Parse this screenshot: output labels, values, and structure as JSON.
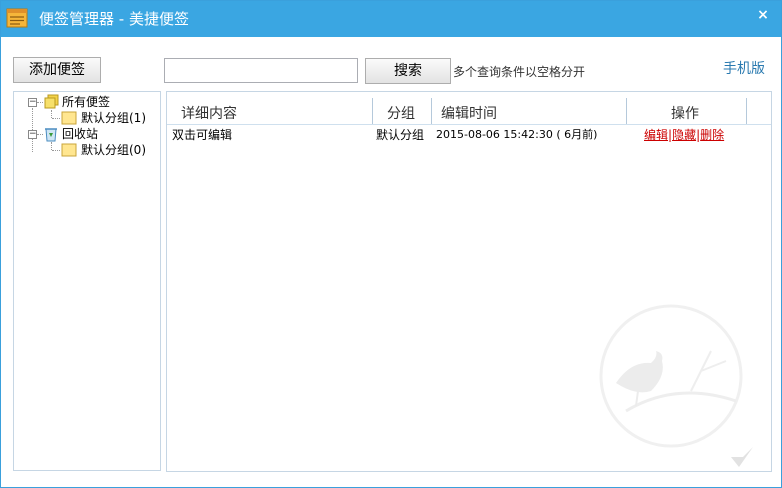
{
  "window": {
    "title": "便签管理器 - 美捷便签",
    "close_label": "×"
  },
  "toolbar": {
    "add_label": "添加便签",
    "search_value": "",
    "search_placeholder": "",
    "search_label": "搜索",
    "search_hint": "多个查询条件以空格分开",
    "mobile_label": "手机版"
  },
  "tree": {
    "all_notes": "所有便签",
    "all_default_group": "默认分组(1)",
    "recycle_bin": "回收站",
    "recycle_default_group": "默认分组(0)"
  },
  "list": {
    "columns": [
      "详细内容",
      "分组",
      "编辑时间",
      "操作"
    ],
    "rows": [
      {
        "content": "双击可编辑",
        "group": "默认分组",
        "time": "2015-08-06 15:42:30 ( 6月前)",
        "op_edit": "编辑",
        "op_hide": "隐藏",
        "op_delete": "删除",
        "op_sep": "|"
      }
    ]
  },
  "colors": {
    "titlebar": "#3aa6e2",
    "link_red": "#cc0000",
    "link_blue": "#2a7ab0"
  }
}
